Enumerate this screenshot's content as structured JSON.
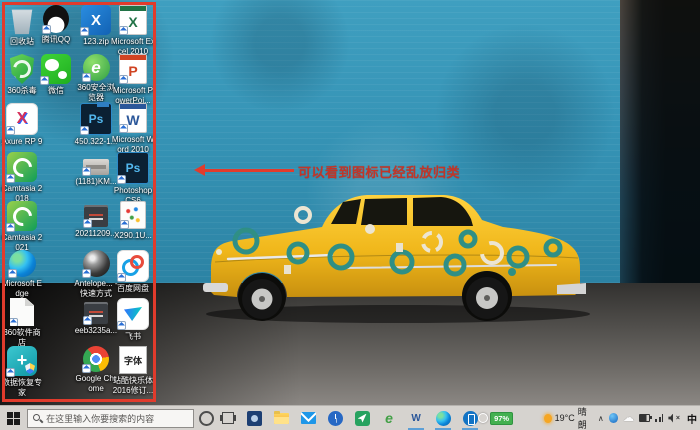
{
  "annotation": {
    "text": "可以看到图标已经乱放归类"
  },
  "colors": {
    "annotation_red": "#e13b2c",
    "taskbar_bg": "#d6d3cf",
    "running_underline_blue": "#5c9fd6",
    "battery_green": "#43b050"
  },
  "desktop": {
    "items": [
      {
        "label": "回收站",
        "kind": "recycle",
        "col": 0,
        "row": 0,
        "shortcut": false
      },
      {
        "label": "腾讯QQ",
        "kind": "qq",
        "col": 1,
        "row": 0,
        "shortcut": true
      },
      {
        "label": "123.zip",
        "kind": "zipx",
        "glyph": "X",
        "col": 2,
        "row": 0,
        "shortcut": true
      },
      {
        "label": "Microsoft Excel 2010",
        "kind": "office office-excel",
        "name": "excel",
        "glyph": "X",
        "col": 3,
        "row": 0,
        "shortcut": true
      },
      {
        "label": "360杀毒",
        "kind": "shield360",
        "col": 0,
        "row": 1,
        "shortcut": true
      },
      {
        "label": "微信",
        "kind": "wechat",
        "col": 1,
        "row": 1,
        "shortcut": true
      },
      {
        "label": "360安全浏览器",
        "kind": "browser360",
        "glyph": "e",
        "col": 2,
        "row": 1,
        "shortcut": true
      },
      {
        "label": "Microsoft PowerPoi...",
        "kind": "office office-ppt",
        "name": "powerpoint",
        "glyph": "P",
        "col": 3,
        "row": 1,
        "shortcut": true
      },
      {
        "label": "Axure RP 9",
        "kind": "axure",
        "glyph": "X",
        "col": 0,
        "row": 2,
        "shortcut": true
      },
      {
        "label": "450.322-1...",
        "kind": "psd-file",
        "glyph": "Ps",
        "col": 2,
        "row": 2,
        "shortcut": true
      },
      {
        "label": "Microsoft Word 2010",
        "kind": "office office-word",
        "name": "word",
        "glyph": "W",
        "col": 3,
        "row": 2,
        "shortcut": true
      },
      {
        "label": "Camtasia 2018",
        "kind": "camtasia",
        "col": 0,
        "row": 3,
        "shortcut": true
      },
      {
        "label": "(1181)KM...",
        "kind": "gray-file",
        "col": 2,
        "row": 3,
        "shortcut": true
      },
      {
        "label": "Photoshop CS6",
        "kind": "ps-app",
        "glyph": "Ps",
        "col": 3,
        "row": 3,
        "shortcut": true
      },
      {
        "label": "Camtasia 2021",
        "kind": "camtasia",
        "col": 0,
        "row": 4,
        "shortcut": true
      },
      {
        "label": "20211209...",
        "kind": "dark-file",
        "col": 2,
        "row": 4,
        "shortcut": true
      },
      {
        "label": "X290.1U...",
        "kind": "spec-file",
        "col": 3,
        "row": 4,
        "shortcut": true
      },
      {
        "label": "Microsoft Edge",
        "kind": "edge",
        "col": 0,
        "row": 5,
        "shortcut": true
      },
      {
        "label": "Antelope... - 快速方式",
        "kind": "lens",
        "col": 2,
        "row": 5,
        "shortcut": true
      },
      {
        "label": "百度网盘",
        "kind": "baidu-pan",
        "col": 3,
        "row": 5,
        "shortcut": true
      },
      {
        "label": "360软件商店",
        "kind": "blank-doc",
        "col": 0,
        "row": 6,
        "shortcut": true
      },
      {
        "label": "eeb3235a...",
        "kind": "dark-file",
        "col": 2,
        "row": 6,
        "shortcut": true
      },
      {
        "label": "飞书",
        "kind": "feishu",
        "col": 3,
        "row": 6,
        "shortcut": true
      },
      {
        "label": "数据恢复专家",
        "kind": "recovery",
        "glyph": "+",
        "col": 0,
        "row": 7,
        "shortcut": true
      },
      {
        "label": "Google Chrome",
        "kind": "chrome",
        "col": 2,
        "row": 7,
        "shortcut": true
      },
      {
        "label": "站酷快乐体 2016修订...",
        "kind": "font-file",
        "glyph": "字体",
        "col": 3,
        "row": 7,
        "shortcut": false
      }
    ]
  },
  "taskbar": {
    "search": {
      "placeholder": "在这里输入你要搜索的内容"
    },
    "pinned": [
      {
        "name": "photos",
        "running": false
      },
      {
        "name": "file-explorer",
        "running": false
      },
      {
        "name": "mail",
        "running": false
      },
      {
        "name": "clock",
        "running": false
      },
      {
        "name": "green-app",
        "running": false
      },
      {
        "name": "browser-360",
        "glyph": "e",
        "running": false
      },
      {
        "name": "word",
        "glyph": "W",
        "running": true
      },
      {
        "name": "edge",
        "running": true
      },
      {
        "name": "your-phone",
        "running": true
      }
    ],
    "tray": {
      "battery_widget": "97%",
      "weather": {
        "temp": "19°C",
        "condition": "晴朗"
      },
      "ime": "中"
    }
  },
  "icons": {
    "chevron": "∧",
    "cloud": "☁",
    "mute_x": "×"
  }
}
